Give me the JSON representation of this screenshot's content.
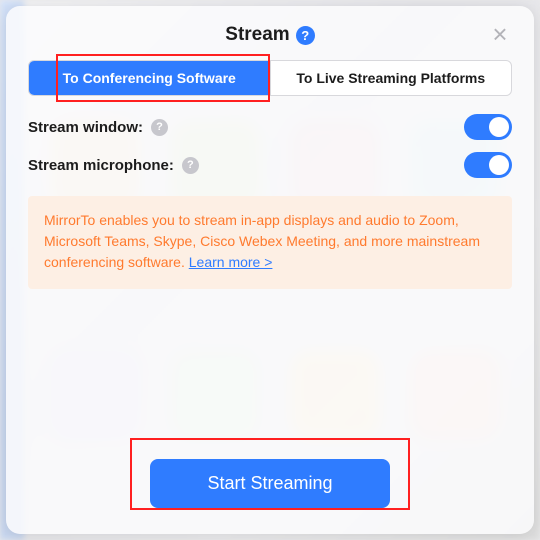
{
  "title": "Stream",
  "tabs": {
    "conferencing": "To Conferencing Software",
    "livePlatforms": "To Live Streaming Platforms"
  },
  "toggles": {
    "window": {
      "label": "Stream window:",
      "on": true
    },
    "microphone": {
      "label": "Stream microphone:",
      "on": true
    }
  },
  "info": {
    "text": "MirrorTo enables you to stream in-app displays and audio to Zoom, Microsoft Teams, Skype, Cisco Webex Meeting, and more mainstream conferencing software. ",
    "learnMore": "Learn more >"
  },
  "cta": "Start Streaming",
  "colors": {
    "accent": "#2f7cff",
    "warnBg": "#fdefe4",
    "warnText": "#ff7a2e"
  },
  "glyphs": {
    "help": "?",
    "close": "×"
  }
}
